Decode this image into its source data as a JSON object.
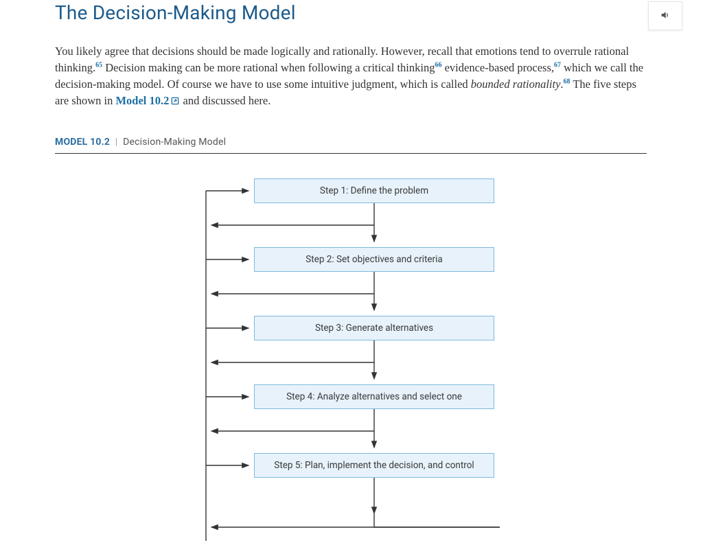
{
  "heading": "The Decision-Making Model",
  "paragraph": {
    "p1a": "You",
    "p1b": " likely agree that decisions should be made logically and rationally. However, recall that emotions tend to overrule rational thinking.",
    "sup65": "65",
    "p2": " Decision making can be more rational when following a critical thinking",
    "sup66": "66",
    "p3": " evidence-based process,",
    "sup67": "67",
    "p4": " which we call the decision-making model. Of course we have to use some intuitive judgment, which is called ",
    "term": "bounded rationality",
    "p5": ".",
    "sup68": "68",
    "p6": " The five steps are shown in ",
    "model_link": "Model 10.2",
    "p7": "  and discussed here."
  },
  "figure": {
    "label": "MODEL 10.2",
    "separator": "|",
    "title": "Decision-Making Model"
  },
  "steps": [
    "Step 1:  Define the problem",
    "Step 2:  Set objectives and criteria",
    "Step 3:  Generate alternatives",
    "Step 4:   Analyze alternatives and select one",
    "Step 5:  Plan, implement the decision, and control"
  ],
  "icons": {
    "audio": "volume-icon",
    "open": "open-new-icon"
  }
}
